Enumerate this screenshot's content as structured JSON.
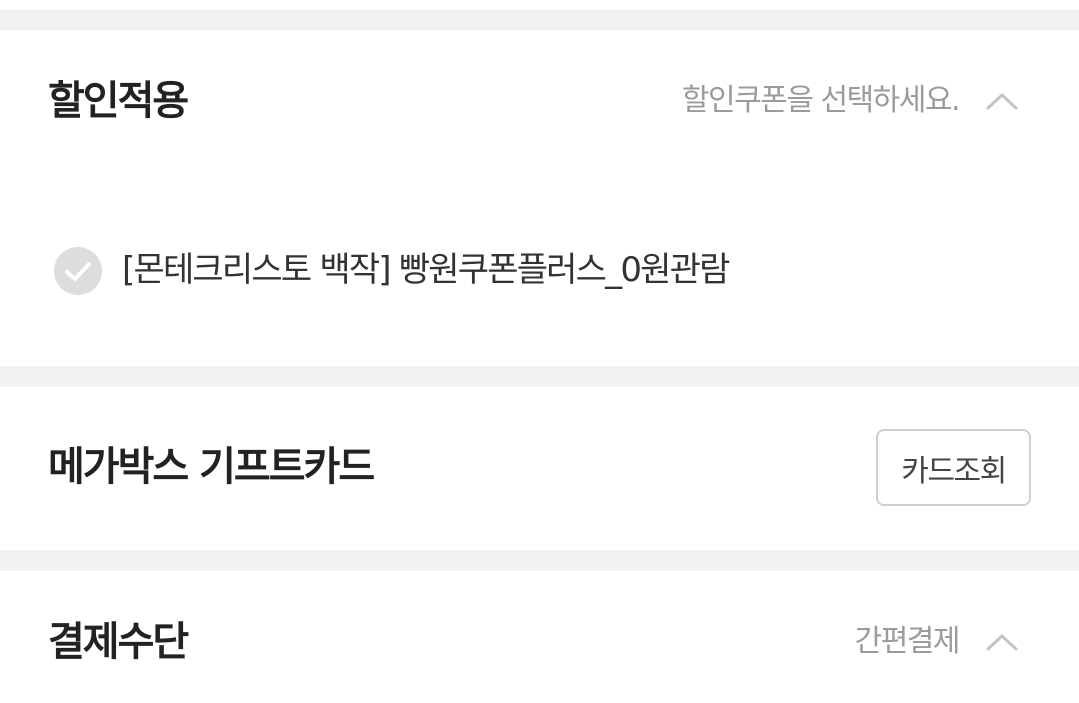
{
  "discount": {
    "title": "할인적용",
    "hint": "할인쿠폰을 선택하세요.",
    "coupon": {
      "label": "[몬테크리스토 백작] 빵원쿠폰플러스_0원관람",
      "selected": false
    }
  },
  "gift_card": {
    "title": "메가박스 기프트카드",
    "lookup_label": "카드조회"
  },
  "payment": {
    "title": "결제수단",
    "hint": "간편결제"
  },
  "icons": {
    "collapse": "chevron-up-icon",
    "check": "checkmark-icon"
  },
  "colors": {
    "section_gap": "#f2f2f2",
    "hint_text": "#9b9b9b",
    "check_circle": "#dddddd"
  }
}
